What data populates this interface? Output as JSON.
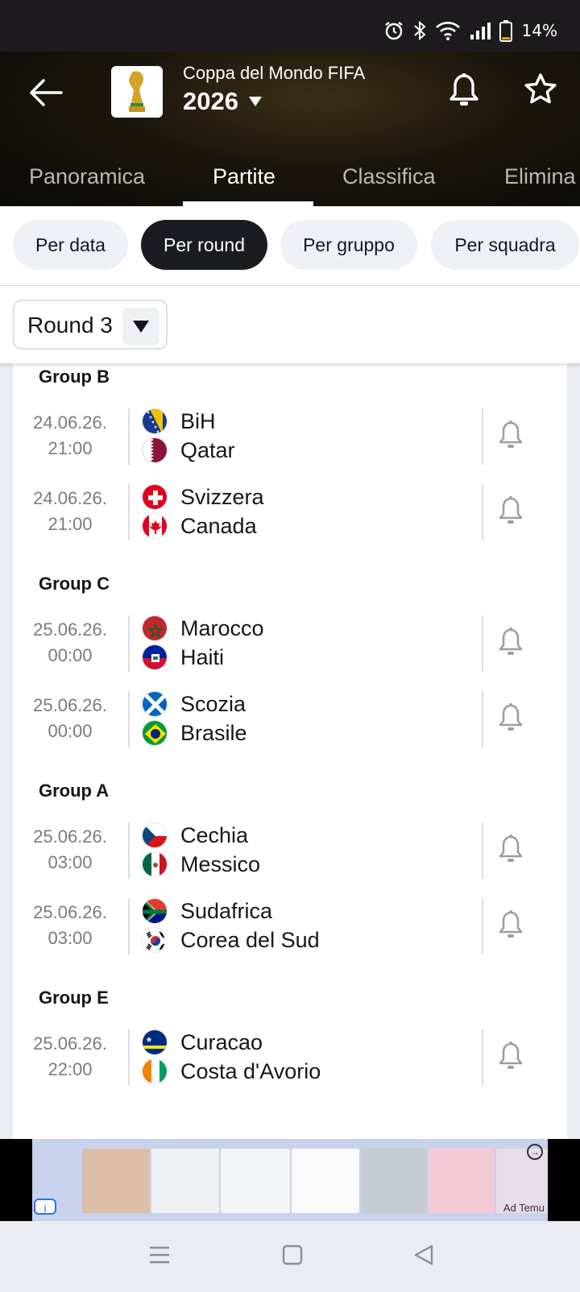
{
  "status_bar": {
    "battery_text": "14%",
    "battery_level_percent": 14,
    "icons": [
      "alarm-icon",
      "bluetooth-icon",
      "wifi-icon",
      "signal-icon",
      "battery-icon"
    ]
  },
  "header": {
    "competition_title": "Coppa del Mondo FIFA",
    "season": "2026",
    "icons": [
      "back-arrow-icon",
      "trophy-logo",
      "bell-icon",
      "star-icon",
      "caret-down-icon"
    ]
  },
  "tabs": [
    {
      "label": "Panoramica",
      "active": false
    },
    {
      "label": "Partite",
      "active": true
    },
    {
      "label": "Classifica",
      "active": false
    },
    {
      "label": "Elimina",
      "active": false
    }
  ],
  "filters": [
    {
      "label": "Per data",
      "active": false
    },
    {
      "label": "Per round",
      "active": true
    },
    {
      "label": "Per gruppo",
      "active": false
    },
    {
      "label": "Per squadra",
      "active": false
    }
  ],
  "round_select": {
    "value": "Round 3"
  },
  "groups": [
    {
      "title": "Group B",
      "matches": [
        {
          "date": "24.06.26.",
          "time": "21:00",
          "home": {
            "name": "BiH",
            "flag": "bih"
          },
          "away": {
            "name": "Qatar",
            "flag": "qatar"
          }
        },
        {
          "date": "24.06.26.",
          "time": "21:00",
          "home": {
            "name": "Svizzera",
            "flag": "switzerland"
          },
          "away": {
            "name": "Canada",
            "flag": "canada"
          }
        }
      ]
    },
    {
      "title": "Group C",
      "matches": [
        {
          "date": "25.06.26.",
          "time": "00:00",
          "home": {
            "name": "Marocco",
            "flag": "morocco"
          },
          "away": {
            "name": "Haiti",
            "flag": "haiti"
          }
        },
        {
          "date": "25.06.26.",
          "time": "00:00",
          "home": {
            "name": "Scozia",
            "flag": "scotland"
          },
          "away": {
            "name": "Brasile",
            "flag": "brazil"
          }
        }
      ]
    },
    {
      "title": "Group A",
      "matches": [
        {
          "date": "25.06.26.",
          "time": "03:00",
          "home": {
            "name": "Cechia",
            "flag": "czechia"
          },
          "away": {
            "name": "Messico",
            "flag": "mexico"
          }
        },
        {
          "date": "25.06.26.",
          "time": "03:00",
          "home": {
            "name": "Sudafrica",
            "flag": "south-africa"
          },
          "away": {
            "name": "Corea del Sud",
            "flag": "south-korea"
          }
        }
      ]
    },
    {
      "title": "Group E",
      "matches": [
        {
          "date": "25.06.26.",
          "time": "22:00",
          "home": {
            "name": "Curacao",
            "flag": "curacao"
          },
          "away": {
            "name": "Costa d'Avorio",
            "flag": "ivory-coast"
          }
        }
      ]
    }
  ],
  "ad": {
    "label": "Ad Temu"
  },
  "nav_bar": {
    "icons": [
      "menu-icon",
      "home-icon",
      "back-icon"
    ]
  }
}
